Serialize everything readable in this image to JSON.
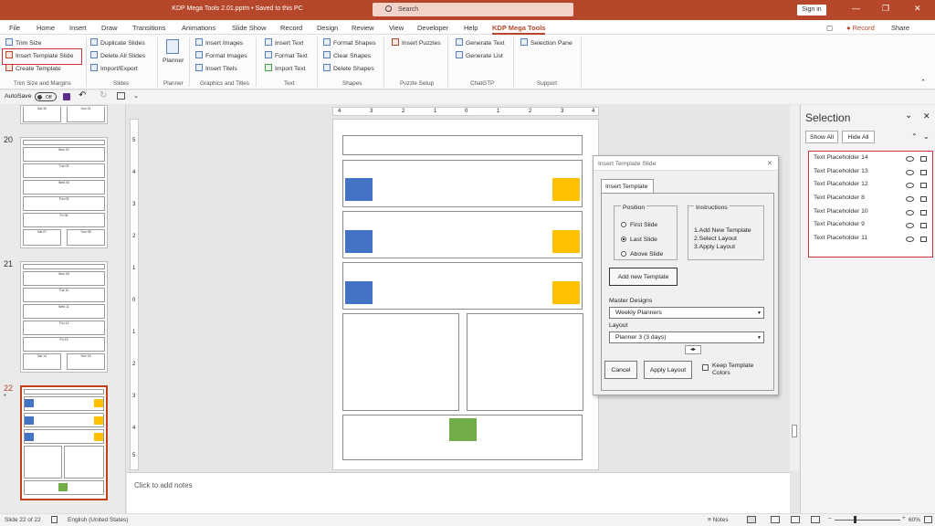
{
  "titlebar": {
    "doc_title": "KDP Mega Tools 2.01.pptm • Saved to this PC",
    "search_placeholder": "Search",
    "signin_label": "Sign in",
    "minimize": "—",
    "restore": "❐",
    "close": "✕"
  },
  "tabs": [
    "File",
    "Home",
    "Insert",
    "Draw",
    "Transitions",
    "Animations",
    "Slide Show",
    "Record",
    "Design",
    "Review",
    "View",
    "Developer",
    "Help",
    "KDP Mega Tools"
  ],
  "top_right": {
    "comment": "▢",
    "record": "Record",
    "share": "Share"
  },
  "ribbon": {
    "trim": {
      "trim_size": "Trim Size",
      "insert_template_slide": "Insert Template Slide",
      "create_template": "Create Template",
      "group": "Trim Size and Margins"
    },
    "slides": {
      "duplicate": "Duplicate Slides",
      "delete_all": "Delete All Slides",
      "import_export": "Import/Export",
      "group": "Slides"
    },
    "planner": {
      "label": "Planner",
      "group": "Planner"
    },
    "graphics": {
      "insert_images": "Insert Images",
      "format_images": "Format Images",
      "insert_titels": "Insert Titels",
      "group": "Graphics and Titles"
    },
    "text": {
      "insert_text": "Insert Text",
      "format_text": "Format Text",
      "import_text": "Import Text",
      "group": "Text"
    },
    "shapes": {
      "format_shapes": "Format Shapes",
      "clear_shapes": "Clear Shapes",
      "delete_shapes": "Delete Shapes",
      "group": "Shapes"
    },
    "puzzle": {
      "insert_puzzles": "Insert Puzzles",
      "group": "Puzzle Setup"
    },
    "chatgtp": {
      "generate_text": "Generate Text",
      "generate_list": "Generate List",
      "group": "ChatGTP"
    },
    "support": {
      "selection_pane": "Selection Pane",
      "group": "Support"
    }
  },
  "qat": {
    "autosave": "AutoSave",
    "toggle": "Off"
  },
  "thumbs": {
    "slide19": {
      "boxes": [
        "Sat 30",
        "Sun 31"
      ]
    },
    "slide20": {
      "num": "20",
      "rows": [
        "Mon 02",
        "Tue 03",
        "Wed 04",
        "Thu 05",
        "Fri 06"
      ],
      "bottom": [
        "Sat 07",
        "Sun 08"
      ]
    },
    "slide21": {
      "num": "21",
      "rows": [
        "Mon 09",
        "Tue 10",
        "Wed 11",
        "Thu 12",
        "Fri 13"
      ],
      "bottom": [
        "Sat 14",
        "Sun 15"
      ]
    },
    "slide22": {
      "num": "22",
      "star": "*"
    }
  },
  "ruler": {
    "h_ticks": [
      "4",
      "3",
      "2",
      "1",
      "0",
      "1",
      "2",
      "3",
      "4"
    ],
    "v_ticks": [
      "5",
      "4",
      "3",
      "2",
      "1",
      "0",
      "1",
      "2",
      "3",
      "4",
      "5"
    ]
  },
  "notes_placeholder": "Click to add notes",
  "dialog": {
    "title": "Insert Template Slide",
    "close": "✕",
    "tab": "Insert Template",
    "position_label": "Position",
    "first_slide": "First Slide",
    "last_slide": "Last Slide",
    "above_slide": "Above Slide",
    "instructions_label": "Instructions",
    "instructions": [
      "1.Add New Template",
      "2.Select Layout",
      "3.Apply Layout"
    ],
    "add_template": "Add new Template",
    "master_designs_label": "Master Designs",
    "master_designs_value": "Weekly Planners",
    "layout_label": "Layout",
    "layout_value": "Planner 3 (3 days)",
    "cancel": "Cancel",
    "apply": "Apply Layout",
    "keep_colors": "Keep Template Colors"
  },
  "selection": {
    "title": "Selection",
    "show_all": "Show All",
    "hide_all": "Hide All",
    "items": [
      "Text Placeholder 14",
      "Text Placeholder 13",
      "Text Placeholder 12",
      "Text Placeholder 8",
      "Text Placeholder 10",
      "Text Placeholder 9",
      "Text Placeholder 11"
    ]
  },
  "status": {
    "slide": "Slide 22 of 22",
    "language": "English (United States)",
    "notes": "Notes",
    "zoom": "60%"
  },
  "colors": {
    "brand": "#b7472a",
    "blue": "#4472c4",
    "yellow": "#ffc000",
    "green": "#70ad47",
    "highlight": "#d13438"
  }
}
